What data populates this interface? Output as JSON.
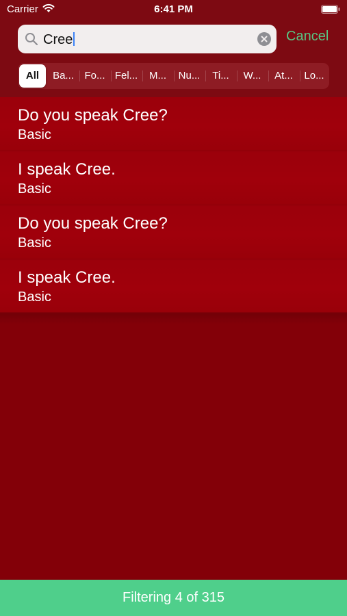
{
  "status_bar": {
    "carrier": "Carrier",
    "time": "6:41 PM"
  },
  "search": {
    "query": "Cree",
    "cancel_label": "Cancel"
  },
  "segments": [
    {
      "label": "All",
      "selected": true
    },
    {
      "label": "Ba..."
    },
    {
      "label": "Fo..."
    },
    {
      "label": "Fel..."
    },
    {
      "label": "M..."
    },
    {
      "label": "Nu..."
    },
    {
      "label": "Ti..."
    },
    {
      "label": "W..."
    },
    {
      "label": "At..."
    },
    {
      "label": "Lo..."
    }
  ],
  "results": [
    {
      "title": "Do you speak Cree?",
      "category": "Basic"
    },
    {
      "title": "I speak Cree.",
      "category": "Basic"
    },
    {
      "title": "Do you speak Cree?",
      "category": "Basic"
    },
    {
      "title": "I speak Cree.",
      "category": "Basic"
    }
  ],
  "footer": {
    "status": "Filtering 4 of 315"
  },
  "colors": {
    "background": "#830008",
    "row": "#a0000b",
    "accent": "#58c785",
    "footer": "#4fcf8b"
  }
}
